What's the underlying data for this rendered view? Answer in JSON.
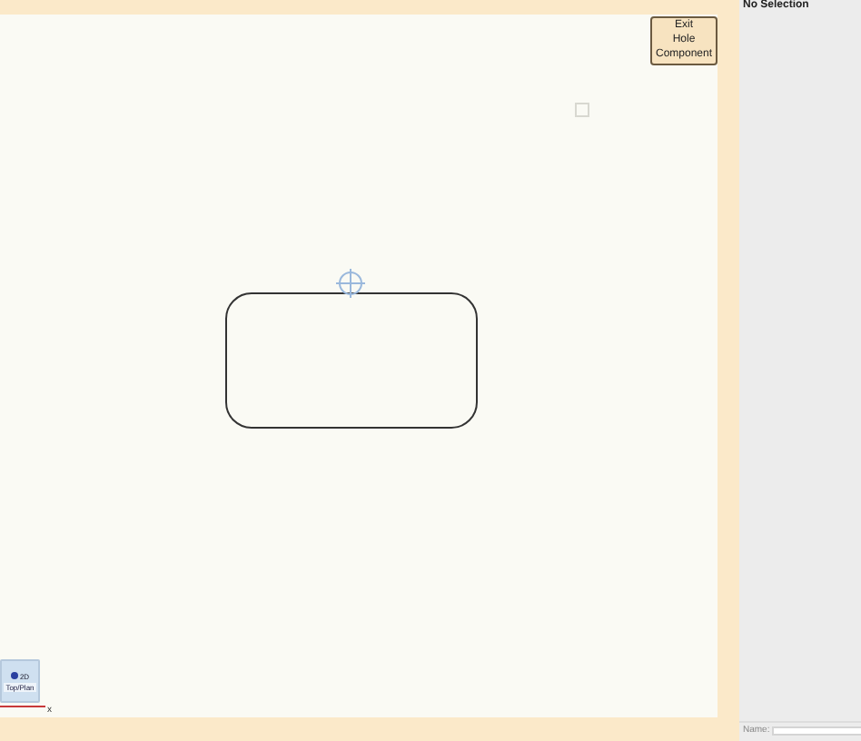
{
  "canvas": {
    "exit_button": {
      "lines": [
        "Exit",
        "Hole",
        "Component"
      ]
    },
    "view_cube": {
      "mode": "2D",
      "view": "Top/Plan"
    },
    "axis": {
      "label": "x"
    }
  },
  "inspector": {
    "header": "No Selection",
    "name_label": "Name:"
  }
}
